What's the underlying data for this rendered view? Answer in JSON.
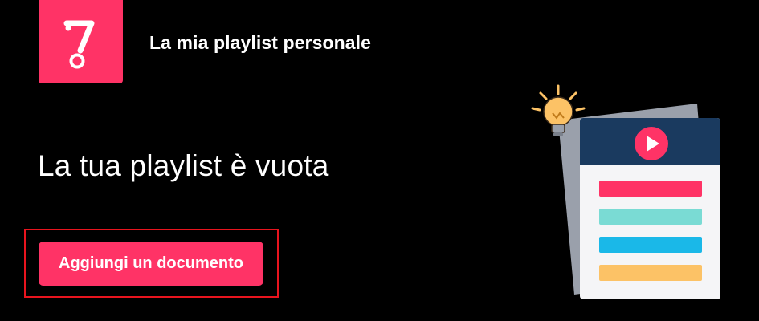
{
  "header": {
    "logo_icon": "brand-7-logo",
    "title": "La mia playlist personale"
  },
  "main": {
    "empty_title": "La tua playlist è vuota",
    "add_button_label": "Aggiungi un documento"
  },
  "illustration": {
    "name": "playlist-with-lightbulb",
    "play_icon": "play-icon",
    "lightbulb_icon": "lightbulb-icon"
  },
  "colors": {
    "background": "#000000",
    "accent": "#ff3366",
    "highlight_border": "#e8141e",
    "card_header": "#1a3a5f",
    "row_pink": "#ff3366",
    "row_teal": "#7adbd4",
    "row_blue": "#1ab8e8",
    "row_orange": "#fcc266"
  }
}
